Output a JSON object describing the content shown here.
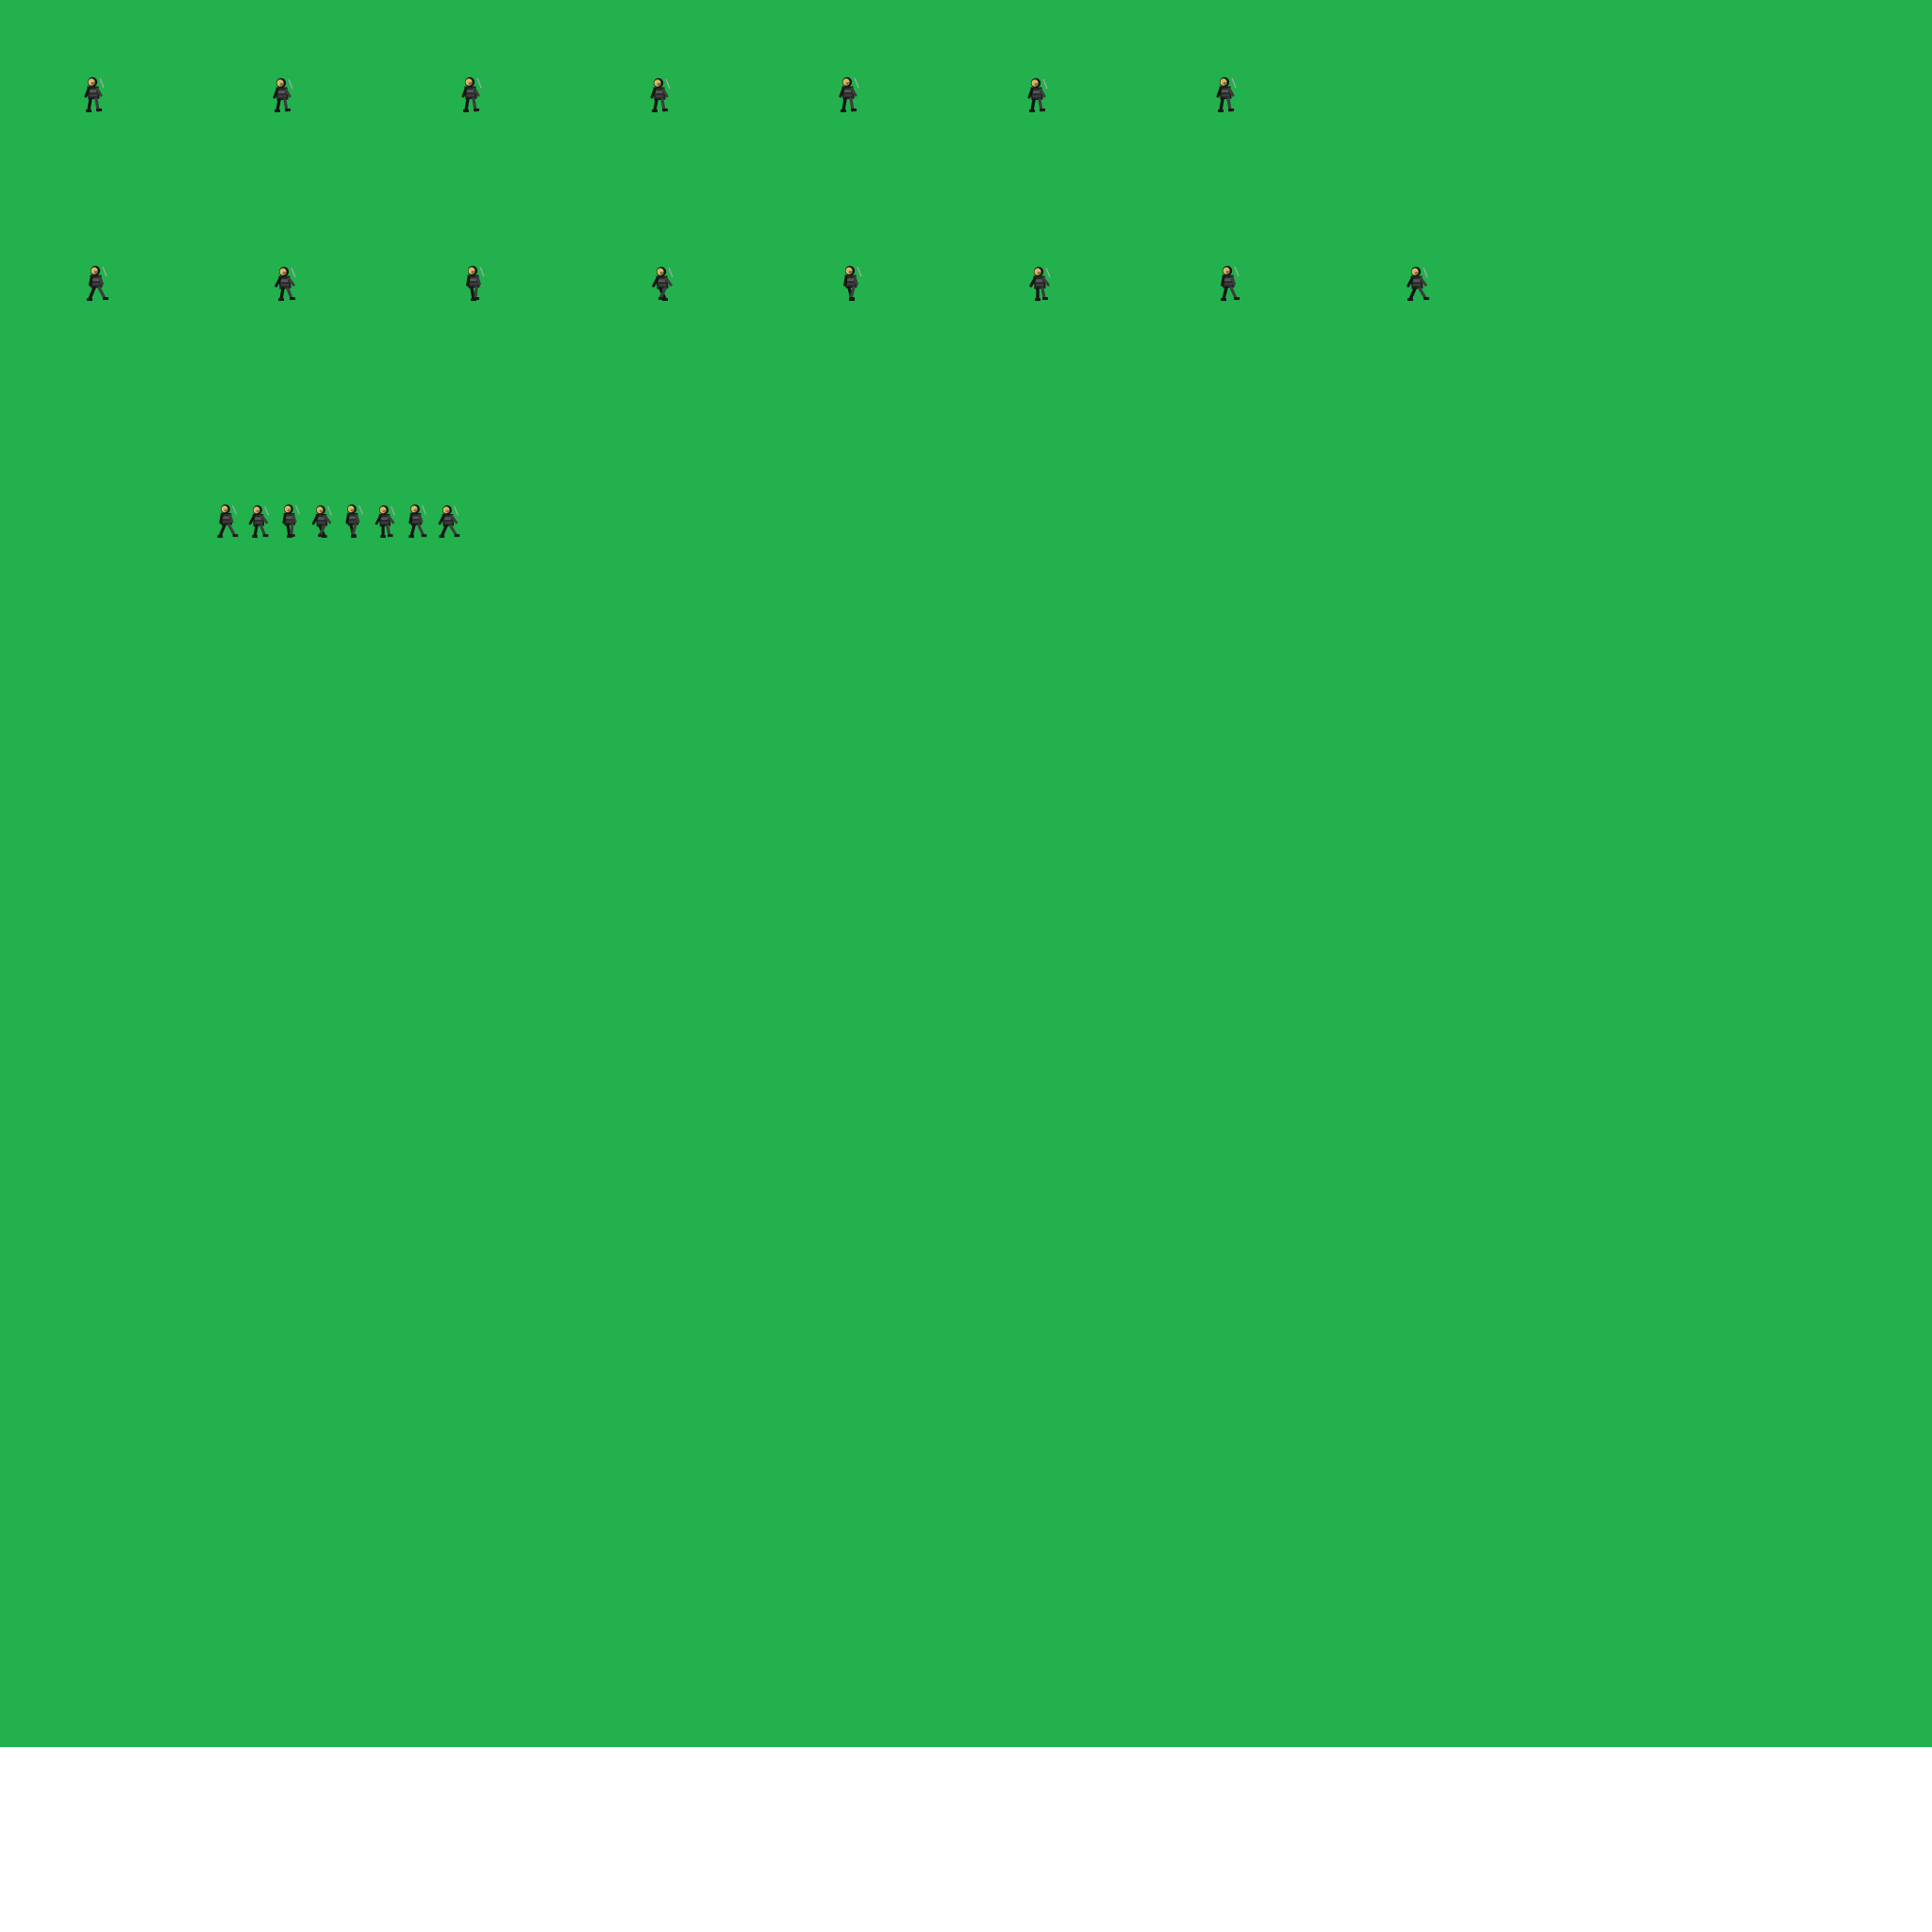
{
  "canvas": {
    "background_color": "#23b14d",
    "outer_color": "#ffffff"
  },
  "sprite_palette": {
    "outline": "#151515",
    "suit_dark": "#2b2b2b",
    "suit_mid": "#3d3d3d",
    "suit_light": "#555555",
    "face": "#d9b66a",
    "face_shadow": "#8f6f32",
    "boot": "#1a1a1a",
    "blade": "#a8a8a8"
  },
  "rows": [
    {
      "name": "idle",
      "icon": "ninja-idle-sprite",
      "frame_count": 7
    },
    {
      "name": "run",
      "icon": "ninja-run-sprite",
      "frame_count": 8
    },
    {
      "name": "run-preview",
      "icon": "ninja-run-sprite",
      "frame_count": 8
    }
  ]
}
